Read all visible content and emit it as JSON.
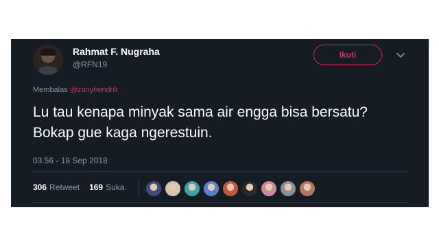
{
  "tweet": {
    "display_name": "Rahmat F. Nugraha",
    "handle": "@RFN19",
    "follow_label": "Ikuti",
    "replying_prefix": "Membalas",
    "replying_to": "@zanyhendrik",
    "text": "Lu tau kenapa minyak sama air engga bisa bersatu? Bokap gue kaga ngerestuin.",
    "timestamp": "03.56 - 18 Sep 2018",
    "retweets": {
      "count": "306",
      "label": "Retweet"
    },
    "likes": {
      "count": "169",
      "label": "Suka"
    }
  },
  "likers": [
    {
      "icon": "liker-avatar",
      "color": "#3d4f7a"
    },
    {
      "icon": "liker-avatar",
      "color": "#d9c3b0"
    },
    {
      "icon": "liker-avatar",
      "color": "#3aa3a8"
    },
    {
      "icon": "liker-avatar",
      "color": "#5a7fd1"
    },
    {
      "icon": "liker-avatar",
      "color": "#c4573a"
    },
    {
      "icon": "liker-avatar",
      "color": "#2b2b2b"
    },
    {
      "icon": "liker-avatar",
      "color": "#c98a9b"
    },
    {
      "icon": "liker-avatar",
      "color": "#8a8f96"
    },
    {
      "icon": "liker-avatar",
      "color": "#b07a5e"
    }
  ],
  "colors": {
    "background": "#151c24",
    "accent": "#e0245e",
    "muted": "#8899a6"
  }
}
